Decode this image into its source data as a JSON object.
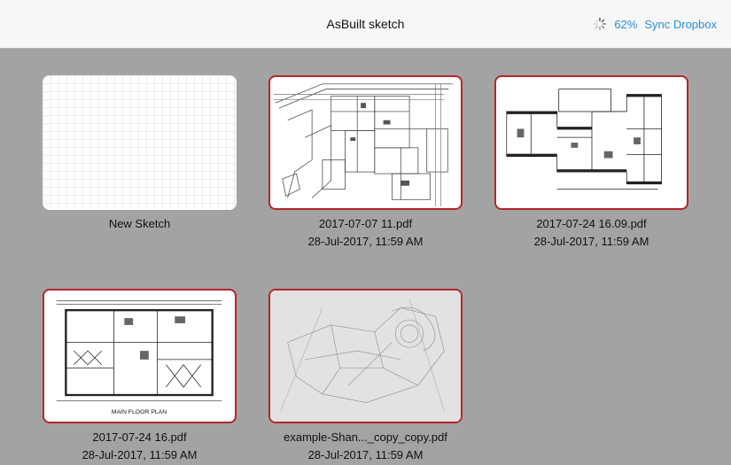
{
  "header": {
    "title": "AsBuilt sketch",
    "sync_percent": "62%",
    "sync_label": "Sync Dropbox"
  },
  "tiles": [
    {
      "name": "New Sketch",
      "date": ""
    },
    {
      "name": "2017-07-07 11.pdf",
      "date": "28-Jul-2017, 11:59 AM"
    },
    {
      "name": "2017-07-24 16.09.pdf",
      "date": "28-Jul-2017, 11:59 AM"
    },
    {
      "name": "2017-07-24 16.pdf",
      "date": "28-Jul-2017, 11:59 AM"
    },
    {
      "name": "example-Shan..._copy_copy.pdf",
      "date": "28-Jul-2017, 11:59 AM"
    }
  ],
  "plan_label": "MAIN FLOOR PLAN",
  "colors": {
    "accent": "#2a8fd6",
    "thumb_border": "#b3262b",
    "background": "#a3a3a3"
  }
}
